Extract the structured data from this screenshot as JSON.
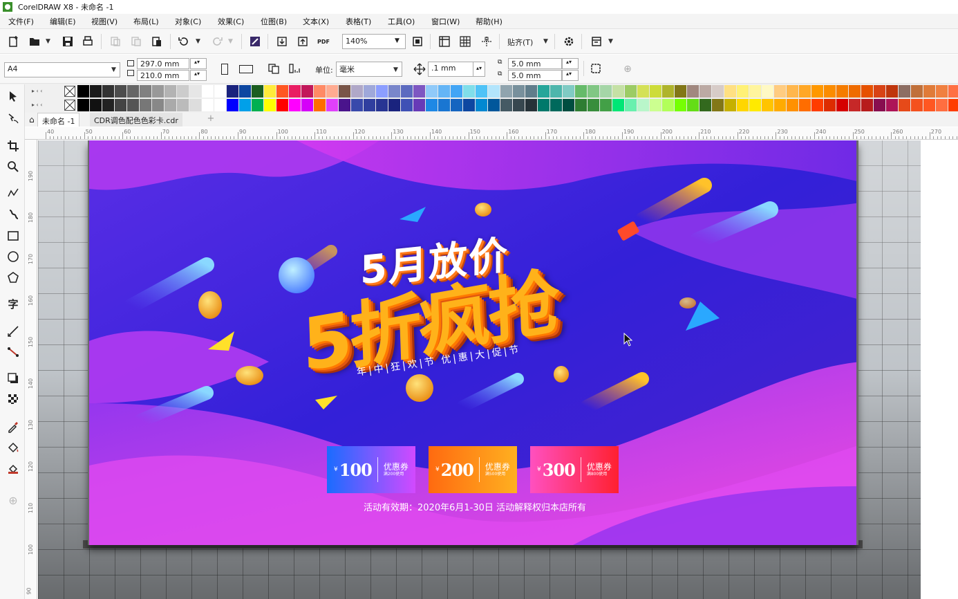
{
  "window": {
    "title": "CorelDRAW X8 - 未命名 -1"
  },
  "menu": [
    "文件(F)",
    "编辑(E)",
    "视图(V)",
    "布局(L)",
    "对象(C)",
    "效果(C)",
    "位图(B)",
    "文本(X)",
    "表格(T)",
    "工具(O)",
    "窗口(W)",
    "帮助(H)"
  ],
  "toolbar": {
    "zoom": "140%",
    "snap_label": "贴齐(T)",
    "icons": [
      "new-icon",
      "open-icon",
      "save-icon",
      "print-icon",
      "cut-icon",
      "copy-icon",
      "paste-icon",
      "undo-icon",
      "redo-icon",
      "corel-connect-icon",
      "import-icon",
      "export-icon",
      "publish-pdf-icon",
      "full-screen-icon",
      "show-rulers-icon",
      "show-grid-icon",
      "show-guidelines-icon",
      "options-icon",
      "launcher-icon"
    ]
  },
  "propertybar": {
    "page_size": "A4",
    "width": "297.0 mm",
    "height": "210.0 mm",
    "units_label": "单位:",
    "units_value": "毫米",
    "nudge": ".1 mm",
    "dup_x": "5.0 mm",
    "dup_y": "5.0 mm"
  },
  "doctabs": [
    {
      "label": "未命名 -1",
      "active": true
    },
    {
      "label": "CDR调色配色色彩卡.cdr",
      "active": false
    }
  ],
  "ruler": {
    "h_labels": [
      "40",
      "50",
      "60",
      "70",
      "80",
      "90",
      "100",
      "110",
      "120",
      "130",
      "140",
      "150",
      "160",
      "170",
      "180",
      "190",
      "200",
      "210",
      "220",
      "230",
      "240",
      "250",
      "260",
      "270"
    ],
    "v_labels": [
      "190",
      "180",
      "170",
      "160",
      "150",
      "140",
      "130",
      "120",
      "110",
      "100",
      "90"
    ]
  },
  "tools": [
    "pick-tool-icon",
    "freehand-pick-icon",
    "crop-tool-icon",
    "zoom-tool-icon",
    "freehand-tool-icon",
    "artistic-media-icon",
    "rectangle-tool-icon",
    "ellipse-tool-icon",
    "polygon-tool-icon",
    "text-tool-icon",
    "parallel-dimension-icon",
    "connector-tool-icon",
    "drop-shadow-icon",
    "transparency-icon",
    "eyedropper-icon",
    "interactive-fill-icon",
    "smart-fill-icon",
    "add-tool-icon"
  ],
  "palette": {
    "row1": [
      "#000000",
      "#1a1a1a",
      "#333333",
      "#4d4d4d",
      "#666666",
      "#808080",
      "#999999",
      "#b3b3b3",
      "#cccccc",
      "#e6e6e6",
      "#ffffff",
      "#ffffff",
      "#1a237e",
      "#0d47a1",
      "#1b5e20",
      "#ffeb3b",
      "#ff5722",
      "#e91e63",
      "#c2185b",
      "#ff8a65",
      "#ffab91",
      "#795548",
      "#b0a8c8",
      "#9fa8da",
      "#8c9eff",
      "#7986cb",
      "#5c6bc0",
      "#7e57c2",
      "#90caf9",
      "#64b5f6",
      "#42a5f5",
      "#80deea",
      "#4fc3f7",
      "#b3e5fc",
      "#90a4ae",
      "#78909c",
      "#607d8b",
      "#26a69a",
      "#4db6ac",
      "#80cbc4",
      "#66bb6a",
      "#81c784",
      "#a5d6a7",
      "#c5e1a5",
      "#9ccc65",
      "#d4e157",
      "#cddc39",
      "#afb42b",
      "#827717",
      "#a1887f",
      "#bcaaa4",
      "#d7ccc8",
      "#ffe082",
      "#fff176",
      "#fff59d",
      "#fff9c4",
      "#ffcc80",
      "#ffb74d",
      "#ffa726",
      "#ff9800",
      "#fb8c00",
      "#f57c00",
      "#ef6c00",
      "#e65100",
      "#d84315",
      "#bf360c",
      "#8d6e63",
      "#c0703a",
      "#e07b39",
      "#f08040",
      "#ff7043"
    ],
    "row2": [
      "#000000",
      "#111111",
      "#222222",
      "#444444",
      "#555555",
      "#777777",
      "#888888",
      "#aaaaaa",
      "#bbbbbb",
      "#dddddd",
      "#ffffff",
      "#ffffff",
      "#0000ff",
      "#00a0e9",
      "#00b050",
      "#ffff00",
      "#ff0000",
      "#ff00ff",
      "#d500f9",
      "#ff6d00",
      "#e040fb",
      "#4a148c",
      "#3949ab",
      "#303f9f",
      "#283593",
      "#1a237e",
      "#3f51b5",
      "#673ab7",
      "#1e88e5",
      "#1976d2",
      "#1565c0",
      "#0d47a1",
      "#0288d1",
      "#01579b",
      "#455a64",
      "#37474f",
      "#263238",
      "#00796b",
      "#00695c",
      "#004d40",
      "#2e7d32",
      "#388e3c",
      "#43a047",
      "#00e676",
      "#69f0ae",
      "#b9f6ca",
      "#ccff90",
      "#b2ff59",
      "#76ff03",
      "#64dd17",
      "#33691e",
      "#827717",
      "#c6b000",
      "#ffd600",
      "#ffea00",
      "#ffc400",
      "#ffab00",
      "#ff9100",
      "#ff6d00",
      "#ff3d00",
      "#dd2c00",
      "#d50000",
      "#c62828",
      "#b71c1c",
      "#880e4f",
      "#ad1457",
      "#e64a19",
      "#f4511e",
      "#ff5722",
      "#ff6e40",
      "#ff3d00"
    ]
  },
  "billboard": {
    "headline_top": "5月放价",
    "headline_main": "5折疯抢",
    "subtitle": "年|中|狂|欢|节  优|惠|大|促|节",
    "coupons": [
      {
        "yen": "¥",
        "amount": "100",
        "label": "优惠券",
        "condition": "满200使用"
      },
      {
        "yen": "¥",
        "amount": "200",
        "label": "优惠券",
        "condition": "满500使用"
      },
      {
        "yen": "¥",
        "amount": "300",
        "label": "优惠券",
        "condition": "满800使用"
      }
    ],
    "notice": "活动有效期：2020年6月1-30日    活动解释权归本店所有"
  }
}
